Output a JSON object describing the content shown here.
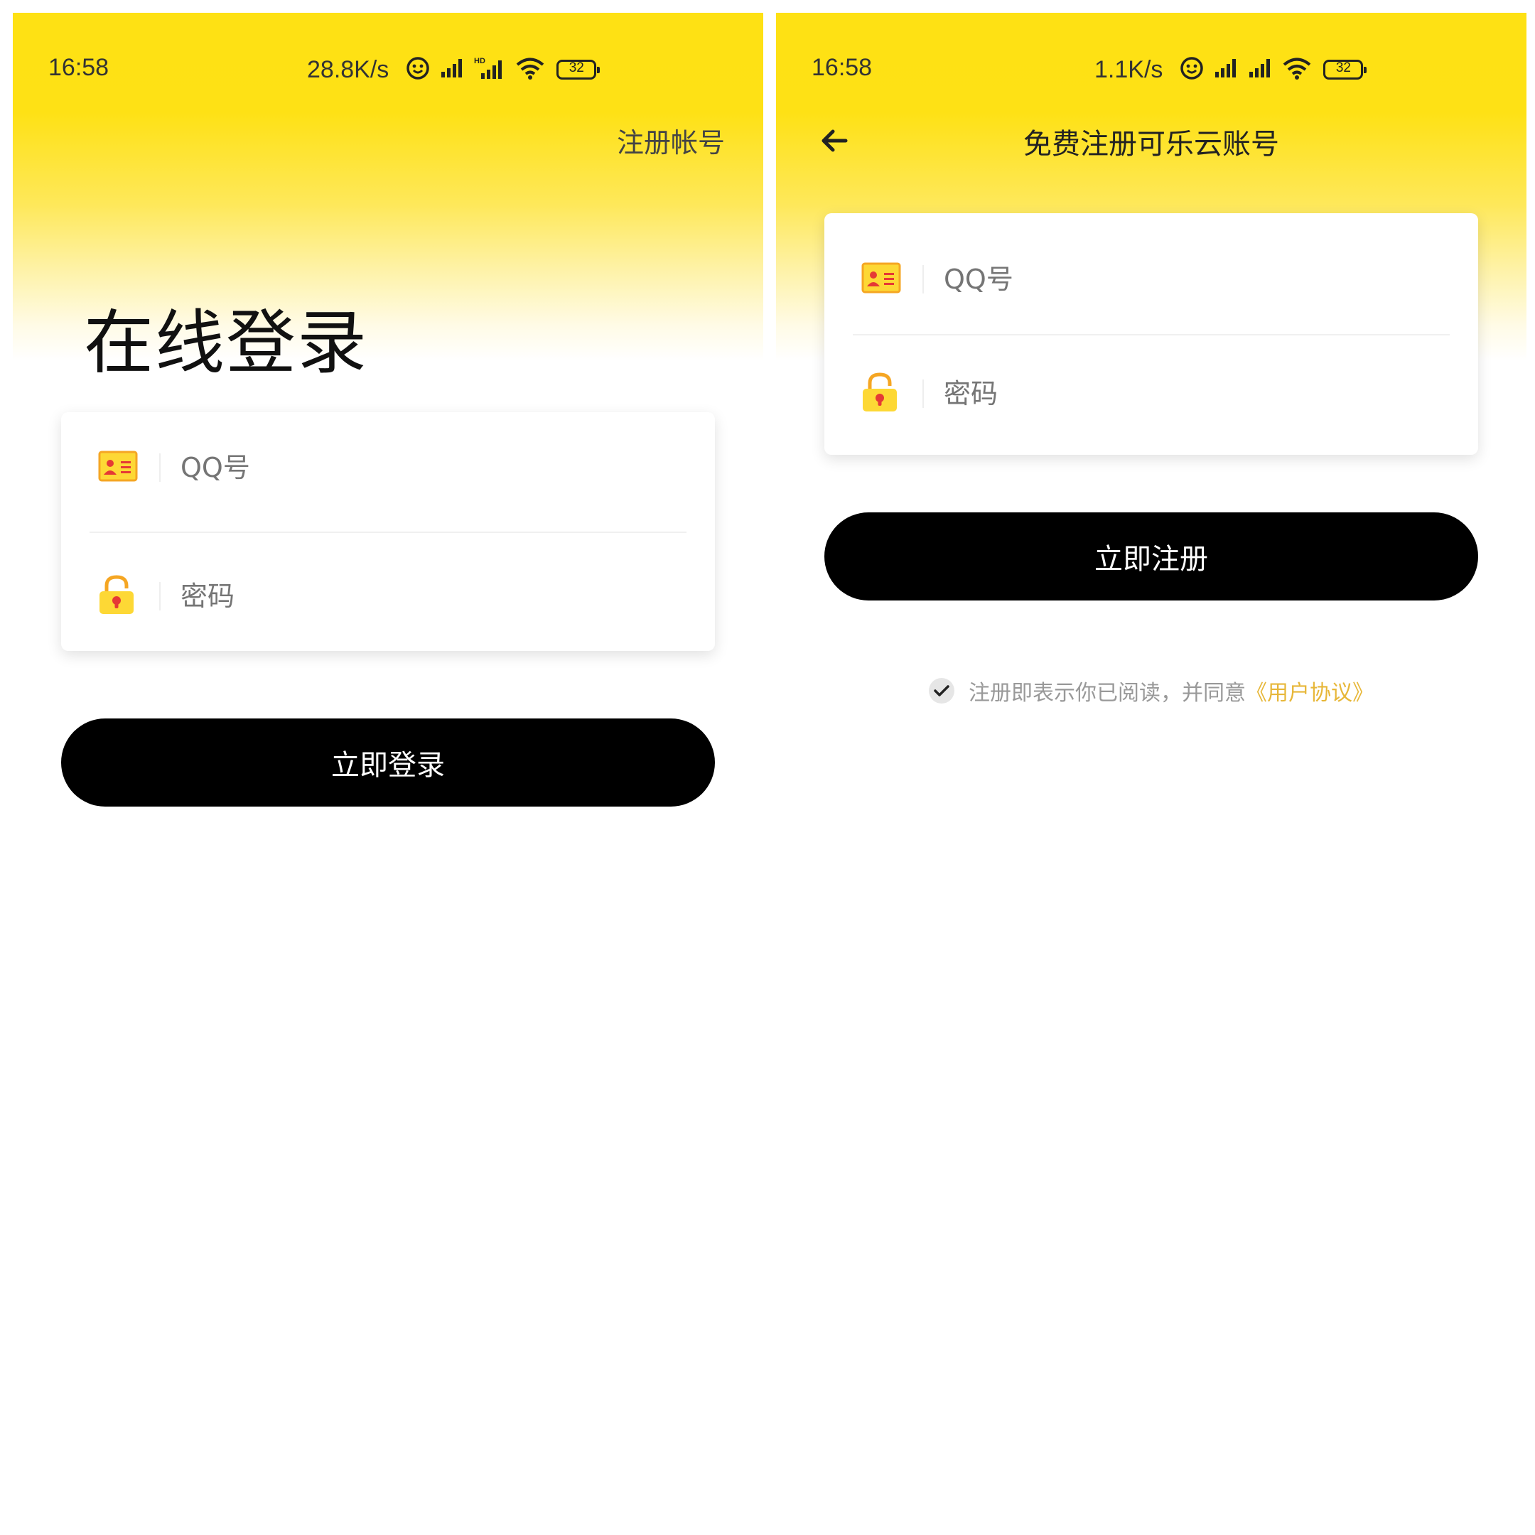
{
  "login_screen": {
    "status": {
      "time": "16:58",
      "speed": "28.8K/s",
      "battery": "32"
    },
    "register_link": "注册帐号",
    "title": "在线登录",
    "qq_placeholder": "QQ号",
    "password_placeholder": "密码",
    "login_button": "立即登录"
  },
  "register_screen": {
    "status": {
      "time": "16:58",
      "speed": "1.1K/s",
      "battery": "32"
    },
    "nav_title": "免费注册可乐云账号",
    "qq_placeholder": "QQ号",
    "password_placeholder": "密码",
    "register_button": "立即注册",
    "agreement_text": "注册即表示你已阅读，并同意",
    "agreement_link": "《用户协议》"
  },
  "colors": {
    "header_yellow": "#fee114",
    "button_black": "#000000",
    "link_gold": "#e7b739",
    "icon_orange": "#f5a623",
    "icon_yellow": "#fdd835",
    "lock_red": "#e53935"
  },
  "icons": [
    "emoji-face-icon",
    "signal-icon",
    "hd-signal-icon",
    "wifi-icon",
    "battery-icon",
    "id-card-icon",
    "lock-icon",
    "back-arrow-icon",
    "check-icon"
  ]
}
